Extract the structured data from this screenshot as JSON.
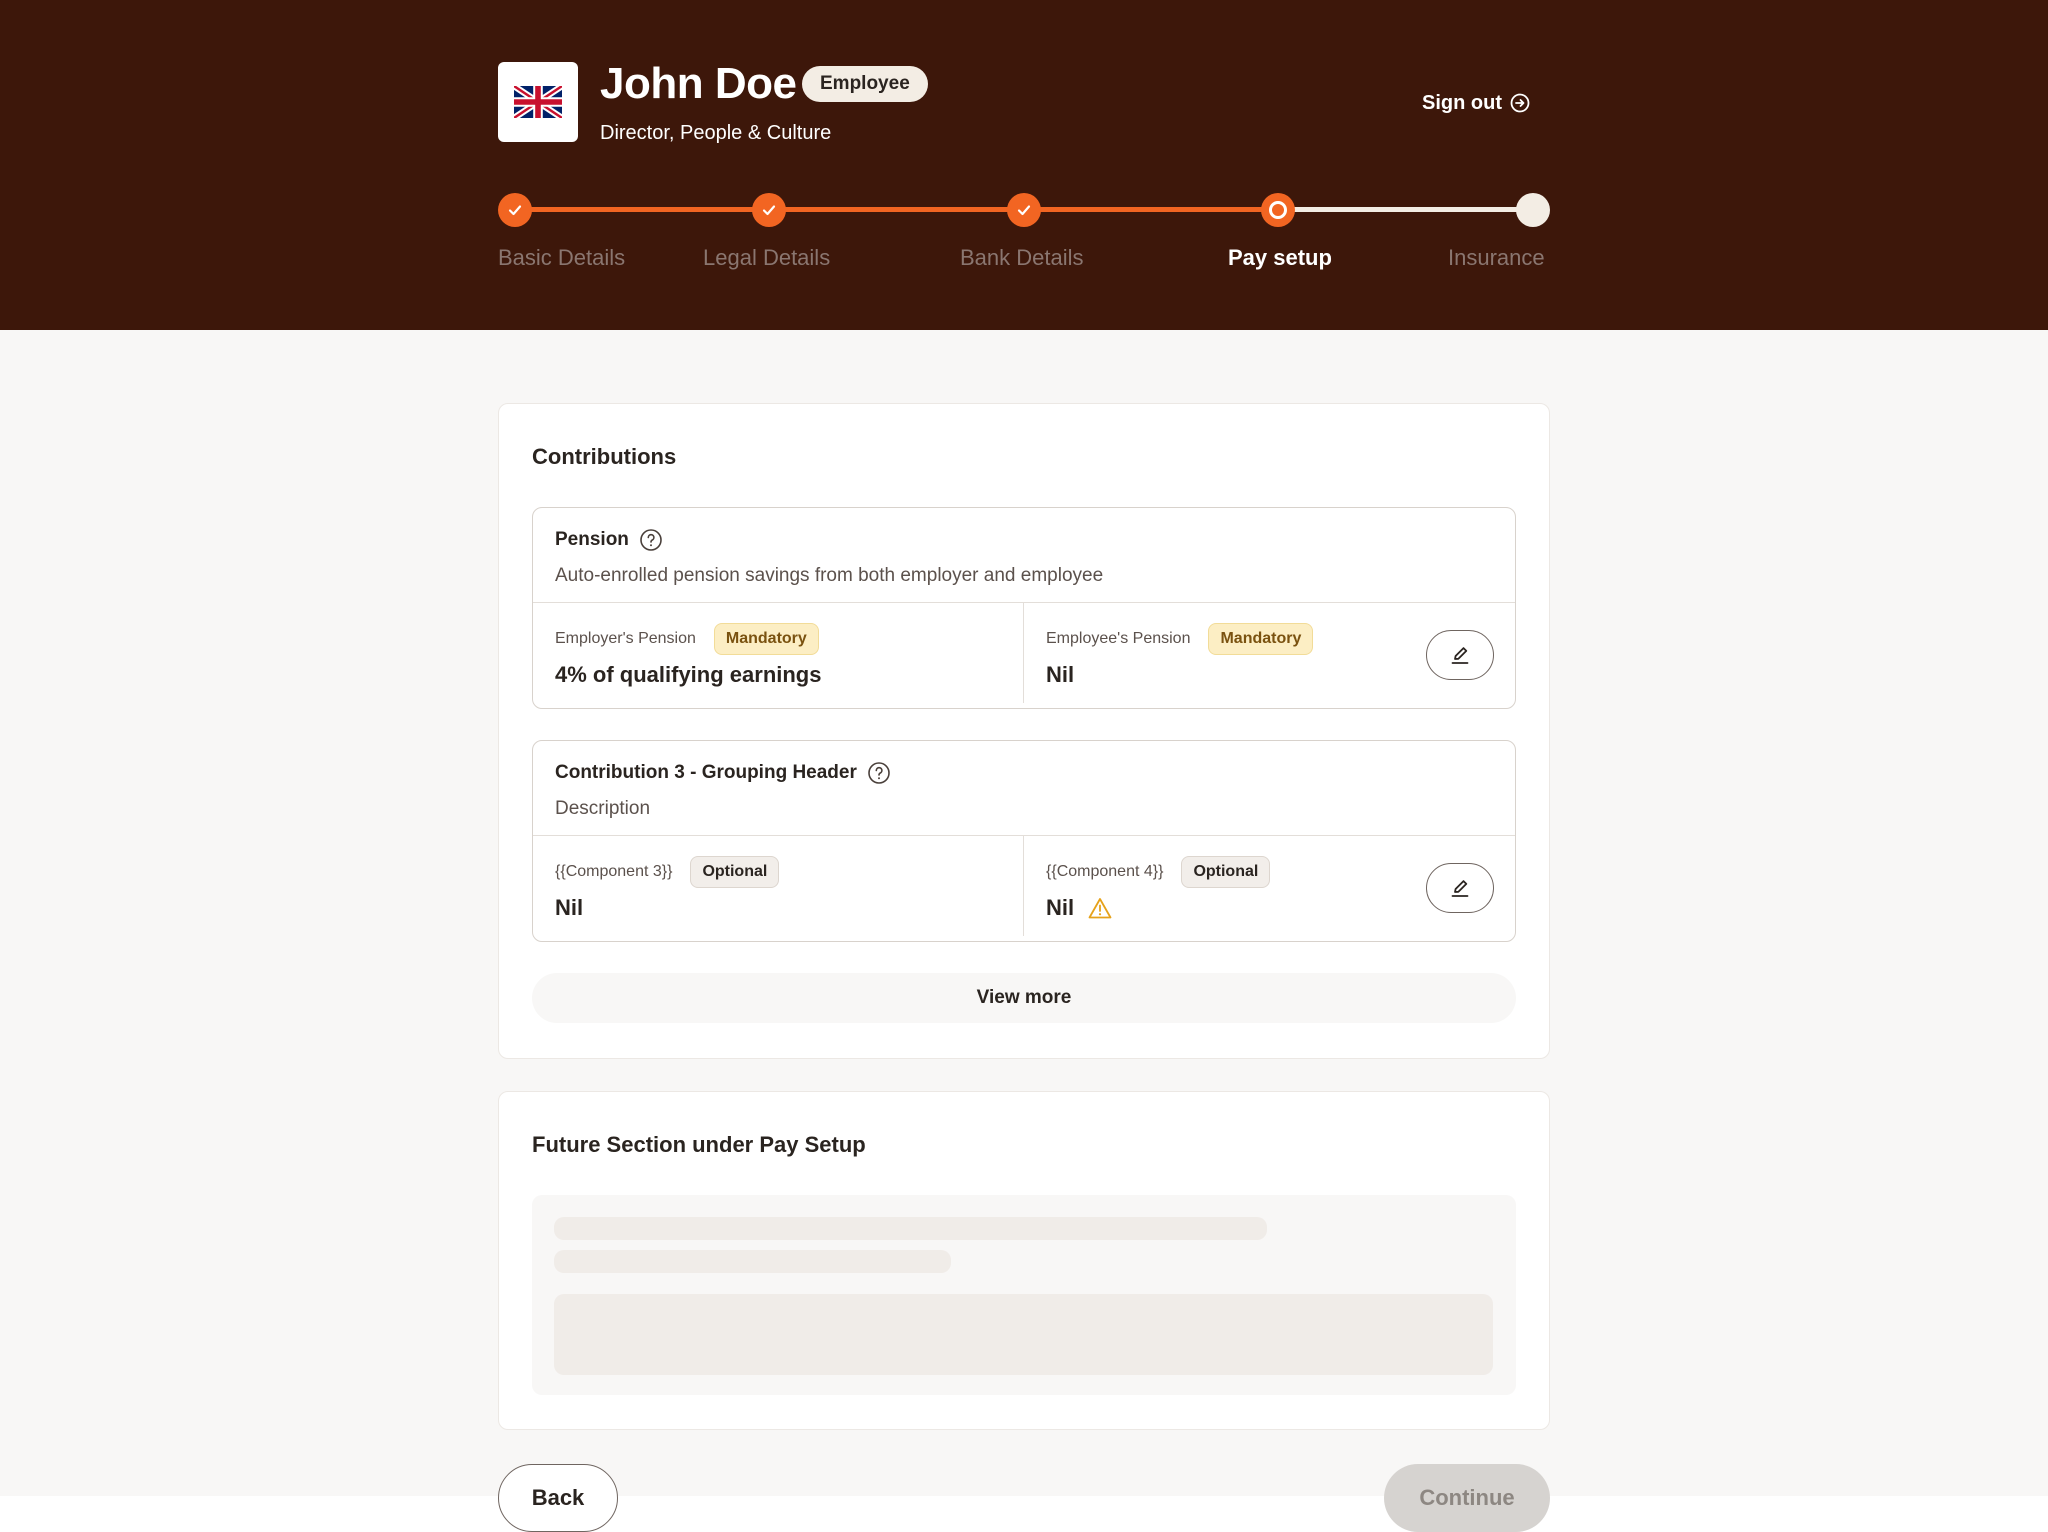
{
  "header": {
    "name": "John Doe",
    "role_badge": "Employee",
    "title": "Director, People & Culture",
    "signout_label": "Sign out",
    "flag_icon": "uk-flag-icon"
  },
  "stepper": {
    "steps": [
      {
        "label": "Basic Details",
        "state": "done"
      },
      {
        "label": "Legal Details",
        "state": "done"
      },
      {
        "label": "Bank Details",
        "state": "done"
      },
      {
        "label": "Pay setup",
        "state": "current"
      },
      {
        "label": "Insurance",
        "state": "todo"
      }
    ]
  },
  "contributions": {
    "title": "Contributions",
    "groups": [
      {
        "name": "Pension",
        "description": "Auto-enrolled pension savings from both employer and employee",
        "left": {
          "label": "Employer's Pension",
          "tag": "Mandatory",
          "value": "4% of qualifying earnings"
        },
        "right": {
          "label": "Employee's Pension",
          "tag": "Mandatory",
          "value": "Nil"
        }
      },
      {
        "name": "Contribution 3 - Grouping Header",
        "description": "Description",
        "left": {
          "label": "{{Component 3}}",
          "tag": "Optional",
          "value": "Nil"
        },
        "right": {
          "label": "{{Component 4}}",
          "tag": "Optional",
          "value": "Nil",
          "warning": "warning-icon"
        }
      }
    ],
    "view_more_label": "View more"
  },
  "future_section": {
    "title": "Future Section under Pay Setup"
  },
  "footer": {
    "back_label": "Back",
    "continue_label": "Continue"
  },
  "colors": {
    "header_bg": "#3d170a",
    "accent": "#f26522",
    "mandatory_bg": "#fceec4",
    "optional_bg": "#f2eeea"
  }
}
